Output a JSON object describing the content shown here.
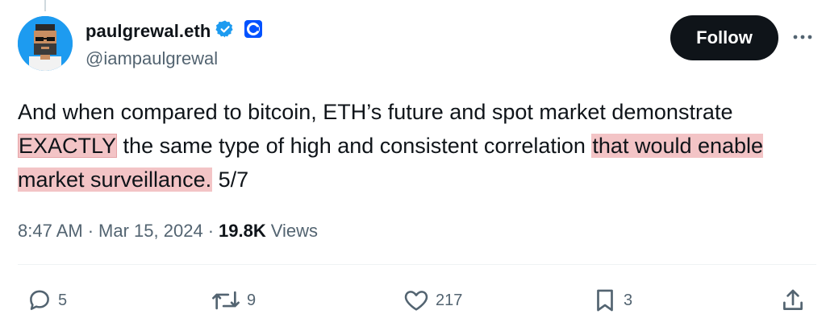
{
  "author": {
    "display_name": "paulgrewal.eth",
    "handle": "@iampaulgrewal",
    "verified_icon": "verified-badge-icon",
    "affiliate_icon": "coinbase-logo-icon",
    "colors": {
      "verified": "#1d9bf0",
      "affiliate": "#0052ff"
    }
  },
  "follow_button": {
    "label": "Follow"
  },
  "tweet": {
    "segments": {
      "s1": "And when compared to bitcoin, ETH’s future and spot market demonstrate ",
      "s2": "EXACTLY",
      "s3": " the same type of high and consistent correlation ",
      "s4": "that would enable market surveillance.",
      "s5": " 5/7"
    },
    "highlight_color": "#f3c4c6"
  },
  "meta": {
    "time": "8:47 AM",
    "separator": "·",
    "date": "Mar 15, 2024",
    "views_count": "19.8K",
    "views_label": "Views"
  },
  "actions": {
    "replies": "5",
    "reposts": "9",
    "likes": "217",
    "bookmarks": "3"
  }
}
